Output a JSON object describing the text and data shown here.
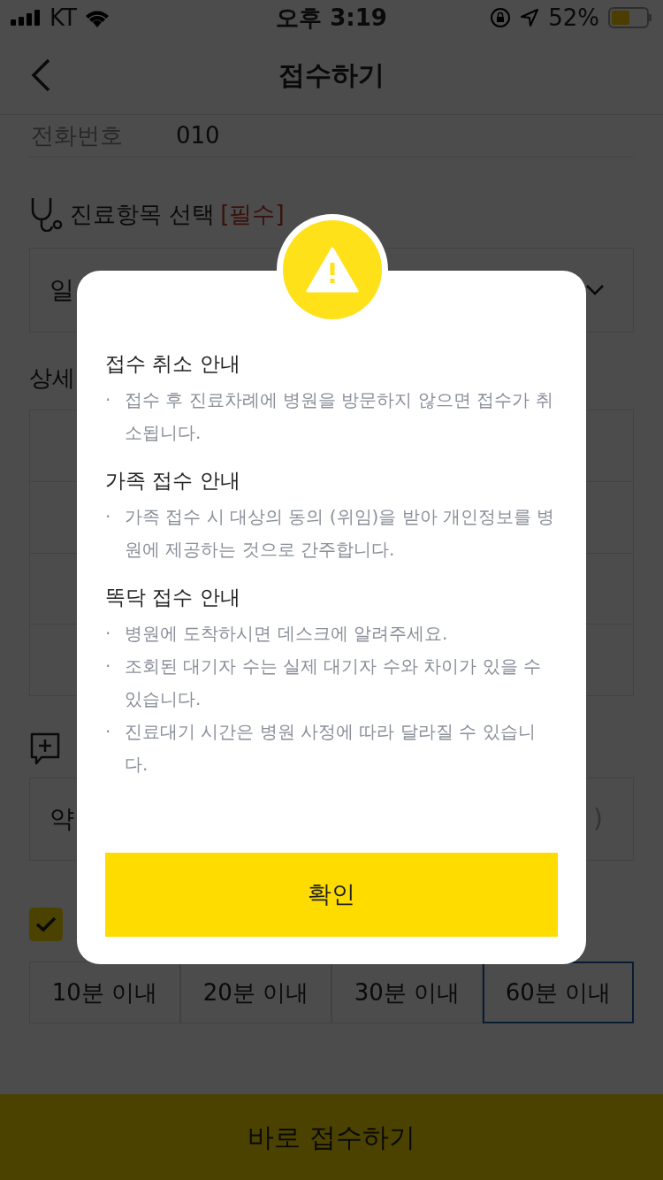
{
  "status_bar": {
    "carrier": "KT",
    "time": "오후 3:19",
    "battery": "52%"
  },
  "header": {
    "title": "접수하기"
  },
  "form": {
    "phone": {
      "label": "전화번호",
      "value": "010"
    },
    "treatment": {
      "label": "진료항목 선택",
      "required": "[필수]",
      "value": "일"
    },
    "detail": {
      "label": "상세"
    },
    "memo": {
      "value": "약",
      "counter": ")"
    },
    "agree": {
      "checked": true
    },
    "wait_options": [
      {
        "label": "10분 이내",
        "selected": false
      },
      {
        "label": "20분 이내",
        "selected": false
      },
      {
        "label": "30분 이내",
        "selected": false
      },
      {
        "label": "60분 이내",
        "selected": true
      }
    ]
  },
  "submit_button": "바로 접수하기",
  "dialog": {
    "sections": [
      {
        "title": "접수 취소 안내",
        "items": [
          {
            "bullet": "·",
            "text": "접수 후 진료차례에 병원을 방문하지 않으면 접수가 취소됩니다."
          }
        ]
      },
      {
        "title": "가족 접수 안내",
        "items": [
          {
            "bullet": "·",
            "text": "가족 접수 시 대상의 동의 (위임)을 받아 개인정보를 병원에 제공하는 것으로 간주합니다."
          }
        ]
      },
      {
        "title": "똑닥 접수 안내",
        "items": [
          {
            "bullet": "·",
            "text": "병원에 도착하시면 데스크에 알려주세요."
          },
          {
            "bullet": "·",
            "text": "조회된 대기자 수는 실제 대기자 수와 차이가 있을 수 있습니다."
          },
          {
            "bullet": "·",
            "text": "진료대기 시간은 병원 사정에 따라 달라질 수 있습니다."
          }
        ]
      }
    ],
    "confirm": "확인"
  }
}
